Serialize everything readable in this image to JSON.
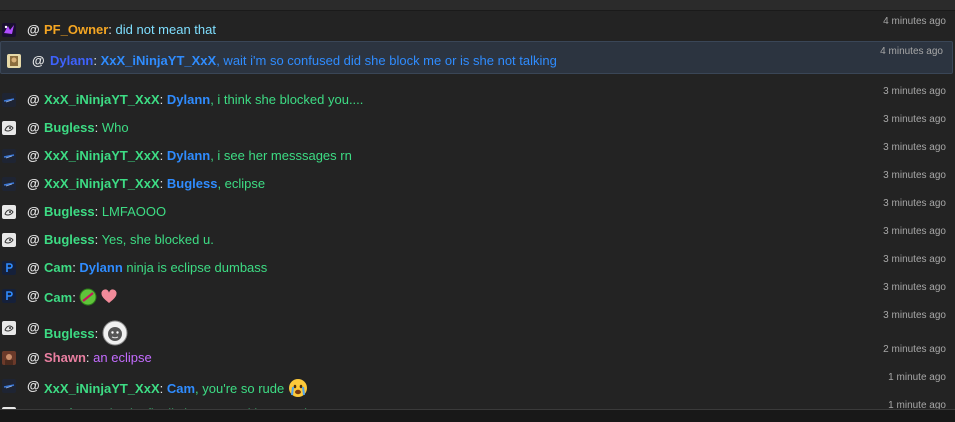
{
  "colors": {
    "orange": "#f5a623",
    "green": "#3ddc84",
    "blue": "#2f8cff",
    "darkblue": "#3e63ff",
    "purple": "#c46cff",
    "pink": "#e97fa1",
    "cyan": "#7fdfff",
    "text": "#e8e8e8",
    "time": "#a7a7a7"
  },
  "chat": [
    {
      "avatar_icon": "purple-game-icon",
      "user": "PF_Owner",
      "user_color": "#f5a623",
      "message": "did not mean that",
      "message_color": "#7fdfff",
      "time": "4 minutes ago"
    },
    {
      "avatar_icon": "character-portrait-icon",
      "user": "Dylann",
      "user_color": "#3e63ff",
      "mention": "XxX_iNinjaYT_XxX",
      "mention_color": "#2f8cff",
      "message": ", wait i'm so confused did she block me or is she not talking",
      "message_color": "#2f8cff",
      "time": "4 minutes ago",
      "highlighted": true
    },
    {
      "avatar_icon": "ninja-logo-icon",
      "user": "XxX_iNinjaYT_XxX",
      "user_color": "#3ddc84",
      "mention": "Dylann",
      "mention_color": "#2f8cff",
      "message": ", i think she blocked you....",
      "message_color": "#3ddc84",
      "time": "3 minutes ago"
    },
    {
      "avatar_icon": "drawing-avatar-icon",
      "user": "Bugless",
      "user_color": "#3ddc84",
      "message": "Who",
      "message_color": "#3ddc84",
      "time": "3 minutes ago"
    },
    {
      "avatar_icon": "ninja-logo-icon",
      "user": "XxX_iNinjaYT_XxX",
      "user_color": "#3ddc84",
      "mention": "Dylann",
      "mention_color": "#2f8cff",
      "message": ", i see her messsages rn",
      "message_color": "#3ddc84",
      "time": "3 minutes ago"
    },
    {
      "avatar_icon": "ninja-logo-icon",
      "user": "XxX_iNinjaYT_XxX",
      "user_color": "#3ddc84",
      "mention": "Bugless",
      "mention_color": "#2f8cff",
      "message": ", eclipse",
      "message_color": "#3ddc84",
      "time": "3 minutes ago"
    },
    {
      "avatar_icon": "drawing-avatar-icon",
      "user": "Bugless",
      "user_color": "#3ddc84",
      "message": "LMFAOOO",
      "message_color": "#3ddc84",
      "time": "3 minutes ago"
    },
    {
      "avatar_icon": "drawing-avatar-icon",
      "user": "Bugless",
      "user_color": "#3ddc84",
      "message": "Yes, she blocked u.",
      "message_color": "#3ddc84",
      "time": "3 minutes ago"
    },
    {
      "avatar_icon": "p-logo-icon",
      "user": "Cam",
      "user_color": "#3ddc84",
      "mention": "Dylann",
      "mention_color": "#2f8cff",
      "message": " ninja is eclipse dumbass",
      "message_color": "#3ddc84",
      "time": "3 minutes ago"
    },
    {
      "avatar_icon": "p-logo-icon",
      "user": "Cam",
      "user_color": "#3ddc84",
      "message": "",
      "message_color": "#3ddc84",
      "emojis": [
        "no-entry-emoji",
        "heart-emoji"
      ],
      "time": "3 minutes ago"
    },
    {
      "avatar_icon": "drawing-avatar-icon",
      "user": "Bugless",
      "user_color": "#3ddc84",
      "message": "",
      "message_color": "#3ddc84",
      "emojis": [
        "face-sticker-emoji"
      ],
      "time": "3 minutes ago"
    },
    {
      "avatar_icon": "photo-avatar-icon",
      "user": "Shawn",
      "user_color": "#e97fa1",
      "message": "an eclipse",
      "message_color": "#c46cff",
      "time": "2 minutes ago"
    },
    {
      "avatar_icon": "ninja-logo-icon",
      "user": "XxX_iNinjaYT_XxX",
      "user_color": "#3ddc84",
      "mention": "Cam",
      "mention_color": "#2f8cff",
      "message": ", you're so rude ",
      "message_color": "#3ddc84",
      "emojis": [
        "crying-face-emoji"
      ],
      "time": "1 minute ago"
    },
    {
      "avatar_icon": "drawing-avatar-icon",
      "user": "Bugless",
      "user_color": "#3ddc84",
      "message": "Also im finally home now i have moi pc",
      "message_color": "#3ddc84",
      "time": "1 minute ago"
    }
  ]
}
